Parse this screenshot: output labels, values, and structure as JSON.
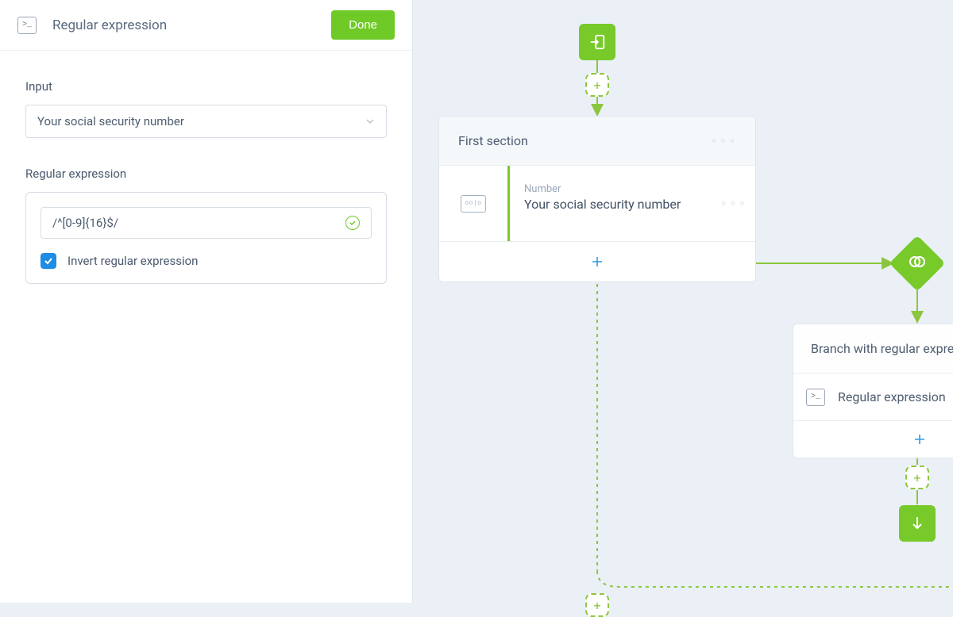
{
  "panel": {
    "title": "Regular expression",
    "done_label": "Done",
    "input_label": "Input",
    "input_value": "Your social security number",
    "regex_label": "Regular expression",
    "regex_value": "/^[0-9]{16}$/",
    "invert_label": "Invert regular expression",
    "invert_checked": true
  },
  "canvas": {
    "section": {
      "title": "First section",
      "question": {
        "type": "Number",
        "title": "Your social security number"
      }
    },
    "branch": {
      "title": "Branch with regular expre",
      "item_label": "Regular expression"
    }
  },
  "colors": {
    "accent_green": "#78c92a",
    "accent_blue": "#2d9de0"
  }
}
